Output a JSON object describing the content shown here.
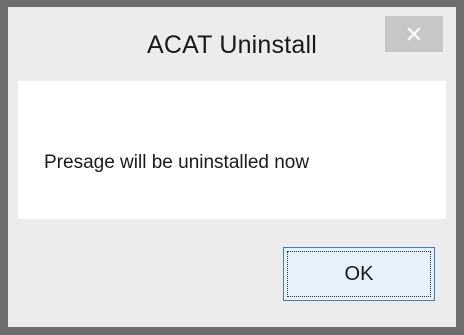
{
  "dialog": {
    "title": "ACAT Uninstall",
    "message": "Presage will be uninstalled now",
    "ok_label": "OK",
    "close_icon": "close-icon"
  }
}
